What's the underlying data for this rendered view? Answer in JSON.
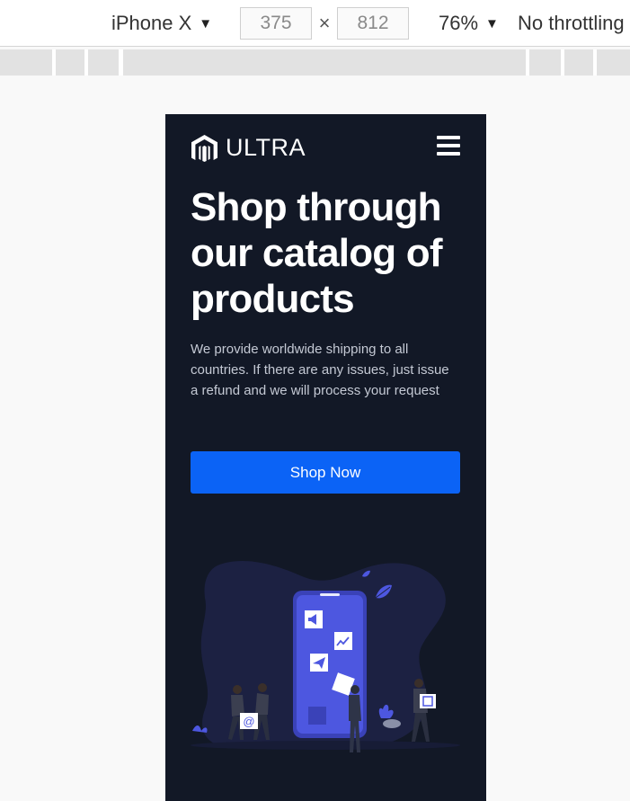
{
  "devtools": {
    "device": "iPhone X",
    "width_value": "375",
    "height_value": "812",
    "dim_separator": "×",
    "zoom": "76%",
    "throttling": "No throttling",
    "caret": "▼"
  },
  "site": {
    "brand": "ULTRA",
    "hero": {
      "title": "Shop through our catalog of products",
      "subtitle": "We provide worldwide shipping to all countries. If there are any issues, just issue a refund and we will process your request",
      "cta_label": "Shop Now"
    },
    "illustration": {
      "badge_symbol": "@"
    }
  },
  "colors": {
    "page_bg": "#121826",
    "accent": "#0b63f6",
    "phone": "#4d57e0",
    "blob": "#1c2142"
  }
}
